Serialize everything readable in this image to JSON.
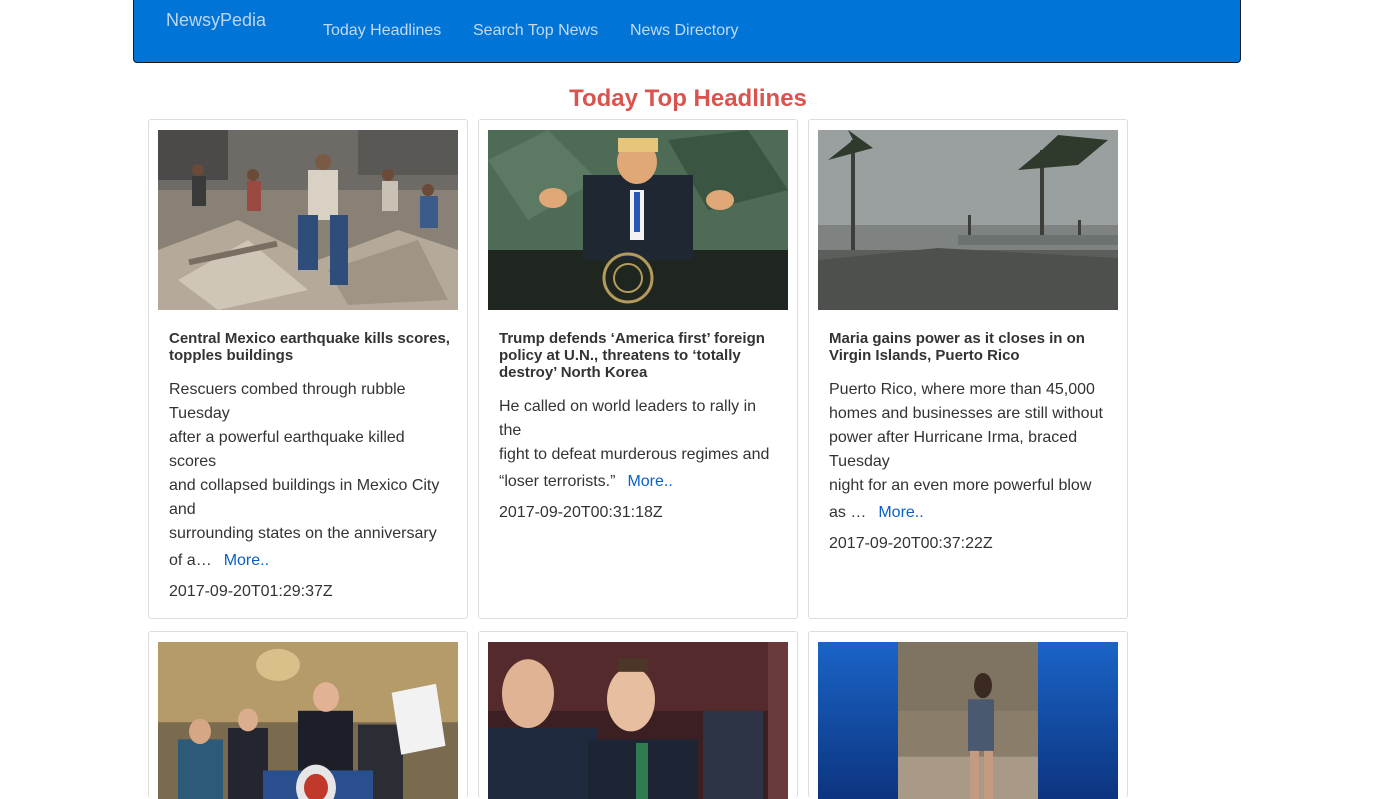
{
  "navbar": {
    "brand": "NewsyPedia",
    "links": [
      "Today Headlines",
      "Search Top News",
      "News Directory"
    ]
  },
  "page_title": "Today Top Headlines",
  "more_label": "More..",
  "articles": [
    {
      "image": "earthquake-rubble-photo",
      "title": "Central Mexico earthquake kills scores, topples buildings",
      "lines": [
        "Rescuers combed through rubble Tuesday",
        "after a powerful earthquake killed scores",
        "and collapsed buildings in Mexico City and",
        "surrounding states on the anniversary"
      ],
      "tail": "of a…",
      "date": "2017-09-20T01:29:37Z"
    },
    {
      "image": "un-speech-photo",
      "title": "Trump defends ‘America first’ foreign policy at U.N., threatens to ‘totally destroy’ North Korea",
      "lines": [
        "He called on world leaders to rally in the",
        "fight to defeat murderous regimes and"
      ],
      "tail": "“loser terrorists.”",
      "date": "2017-09-20T00:31:18Z"
    },
    {
      "image": "hurricane-storm-photo",
      "title": "Maria gains power as it closes in on Virgin Islands, Puerto Rico",
      "lines": [
        "Puerto Rico, where more than 45,000",
        "homes and businesses are still without",
        "power after Hurricane Irma, braced Tuesday",
        "night for an even more powerful blow"
      ],
      "tail": "as …",
      "date": "2017-09-20T00:37:22Z"
    },
    {
      "image": "senate-press-conference-photo"
    },
    {
      "image": "courtroom-portrait-photo"
    },
    {
      "image": "video-runner-photo"
    }
  ]
}
